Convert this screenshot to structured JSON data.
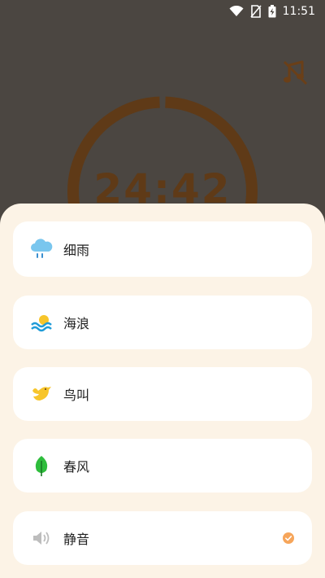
{
  "status_bar": {
    "time": "11:51"
  },
  "timer": {
    "display": "24:42"
  },
  "sounds": [
    {
      "label": "细雨",
      "icon": "cloud-rain-icon"
    },
    {
      "label": "海浪",
      "icon": "sun-waves-icon"
    },
    {
      "label": "鸟叫",
      "icon": "bird-icon"
    },
    {
      "label": "春风",
      "icon": "leaf-icon"
    },
    {
      "label": "静音",
      "icon": "mute-speaker-icon",
      "selected": true
    }
  ],
  "colors": {
    "overlay": "#4b4641",
    "ring": "#5f3a17",
    "sheet": "#fcf3e6",
    "check": "#f6a55a"
  }
}
